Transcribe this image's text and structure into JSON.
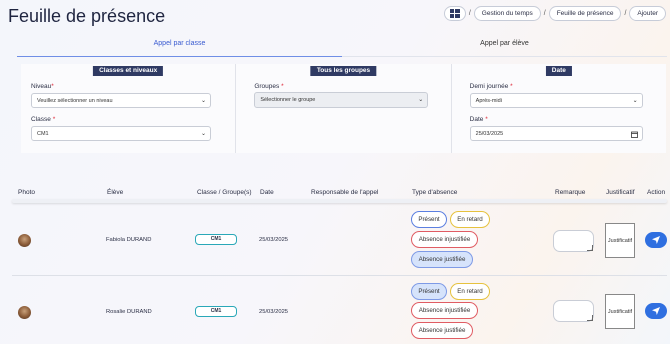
{
  "page": {
    "title": "Feuille de présence"
  },
  "breadcrumb": {
    "items": [
      "Gestion du temps",
      "Feuille de présence",
      "Ajouter"
    ],
    "separator": "/",
    "icon": "dashboard-grid-icon"
  },
  "tabs": [
    {
      "label": "Appel par classe",
      "active": true
    },
    {
      "label": "Appel par élève",
      "active": false
    }
  ],
  "filters": {
    "classes": {
      "header": "Classes et niveaux",
      "niveau_label": "Niveau",
      "niveau_value": "Veuillez sélectionner un niveau",
      "classe_label": "Classe",
      "classe_value": "CM1"
    },
    "groupes": {
      "header": "Tous les groupes",
      "groupes_label": "Groupes",
      "groupes_value": "Sélectionner le groupe"
    },
    "date": {
      "header": "Date",
      "demi_label": "Demi journée",
      "demi_value": "Après-midi",
      "date_label": "Date",
      "date_value": "25/03/2025"
    },
    "required_mark": "*"
  },
  "table": {
    "headers": [
      "Photo",
      "Élève",
      "Classe / Groupe(s)",
      "Date",
      "Responsable de l'appel",
      "Type d'absence",
      "Remarque",
      "Justificatif",
      "Action"
    ],
    "absence_types": {
      "present": "Présent",
      "retard": "En retard",
      "injustifiee": "Absence injustifiée",
      "justifiee": "Absence justifiée"
    },
    "rows": [
      {
        "eleve": "Fabiola DURAND",
        "classe": "CM1",
        "date": "25/03/2025",
        "responsable": "",
        "selected": "justifiee",
        "justificatif": "Justificatif"
      },
      {
        "eleve": "Rosalie DURAND",
        "classe": "CM1",
        "date": "25/03/2025",
        "responsable": "",
        "selected": "present",
        "justificatif": "Justificatif"
      }
    ]
  },
  "colors": {
    "accent": "#2f6fe0",
    "header_bg": "#2f3a63",
    "present_border": "#5b7fe0",
    "retard_border": "#e6c23e",
    "absence_border": "#e05c63",
    "selected_bg": "#d6e3fb"
  }
}
